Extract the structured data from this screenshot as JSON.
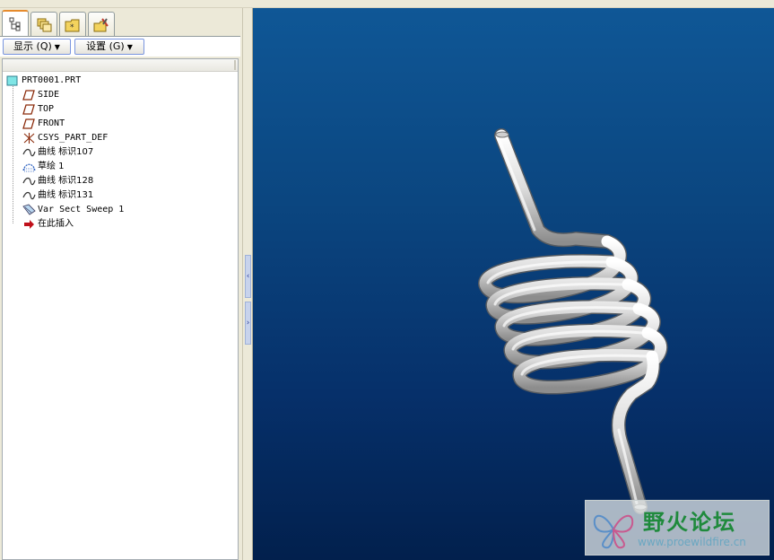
{
  "tabs": [
    {
      "icon": "model-tree-icon",
      "active": true
    },
    {
      "icon": "layers-icon",
      "active": false
    },
    {
      "icon": "folder-browser-icon",
      "active": false
    },
    {
      "icon": "favorites-icon",
      "active": false
    }
  ],
  "toolbar": {
    "show_label": "显示 (Q)",
    "settings_label": "设置 (G)"
  },
  "tree": {
    "root": "PRT0001.PRT",
    "items": [
      {
        "label": "SIDE",
        "icon": "datum-plane-icon"
      },
      {
        "label": "TOP",
        "icon": "datum-plane-icon"
      },
      {
        "label": "FRONT",
        "icon": "datum-plane-icon"
      },
      {
        "label": "CSYS_PART_DEF",
        "icon": "coordinate-system-icon"
      },
      {
        "label": "曲线 标识107",
        "icon": "datum-curve-icon"
      },
      {
        "label": "草绘 1",
        "icon": "sketch-icon"
      },
      {
        "label": "曲线 标识128",
        "icon": "datum-curve-icon"
      },
      {
        "label": "曲线 标识131",
        "icon": "datum-curve-icon"
      },
      {
        "label": "Var Sect Sweep 1",
        "icon": "sweep-icon"
      },
      {
        "label": "在此插入",
        "icon": "insert-here-arrow-icon"
      }
    ]
  },
  "sash": {
    "collapse_glyph": "‹",
    "expand_glyph": "›"
  },
  "watermark": {
    "title": "野火论坛",
    "url": "www.proewildfire.cn"
  },
  "colors": {
    "viewport_top": "#0f5796",
    "viewport_bottom": "#02204d",
    "spring": "#dcdcdc",
    "watermark_green": "#1f8a3c"
  }
}
